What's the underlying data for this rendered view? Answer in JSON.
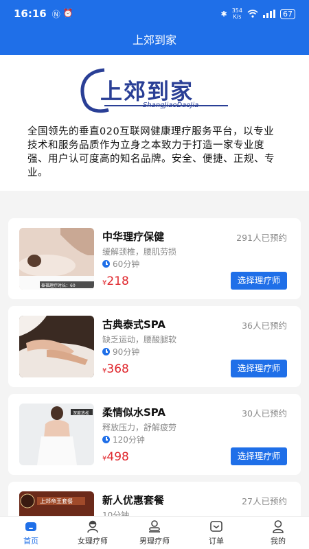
{
  "status": {
    "time": "16:16",
    "net_speed_top": "354",
    "net_speed_bottom": "K/s",
    "battery": "67"
  },
  "header": {
    "title": "上郊到家"
  },
  "logo": {
    "text": "上郊到家",
    "subtext": "ShangJiaoDaoJia"
  },
  "intro": {
    "text": "全国领先的垂直020互联网健康理疗服务平台，以专业技术和服务品质作为立身之本致力于打造一家专业度强、用户认可度高的知名品牌。安全、便捷、正规、专业。"
  },
  "services": [
    {
      "title": "中华理疗保健",
      "count": "291人已预约",
      "desc": "缓解颈椎，腰肌劳损",
      "duration": "60分钟",
      "currency": "¥",
      "price": "218",
      "button": "选择理疗师",
      "thumb_caption": "泰福理疗时长：60"
    },
    {
      "title": "古典泰式SPA",
      "count": "36人已预约",
      "desc": "缺乏运动，腰酸腿软",
      "duration": "90分钟",
      "currency": "¥",
      "price": "368",
      "button": "选择理疗师"
    },
    {
      "title": "柔情似水SPA",
      "count": "30人已预约",
      "desc": "释放压力，舒解疲劳",
      "duration": "120分钟",
      "currency": "¥",
      "price": "498",
      "button": "选择理疗师",
      "thumb_caption": "深度放松"
    },
    {
      "title": "新人优惠套餐",
      "count": "27人已预约",
      "desc": "10分钟",
      "thumb_caption": "上郊帝王套餐"
    }
  ],
  "tabs": [
    {
      "label": "首页",
      "icon": "home-icon"
    },
    {
      "label": "女理疗师",
      "icon": "female-therapist-icon"
    },
    {
      "label": "男理疗师",
      "icon": "male-therapist-icon"
    },
    {
      "label": "订单",
      "icon": "order-icon"
    },
    {
      "label": "我的",
      "icon": "profile-icon"
    }
  ],
  "colors": {
    "primary": "#1f6fe8",
    "price": "#e0272d",
    "logo": "#2a3f96"
  }
}
